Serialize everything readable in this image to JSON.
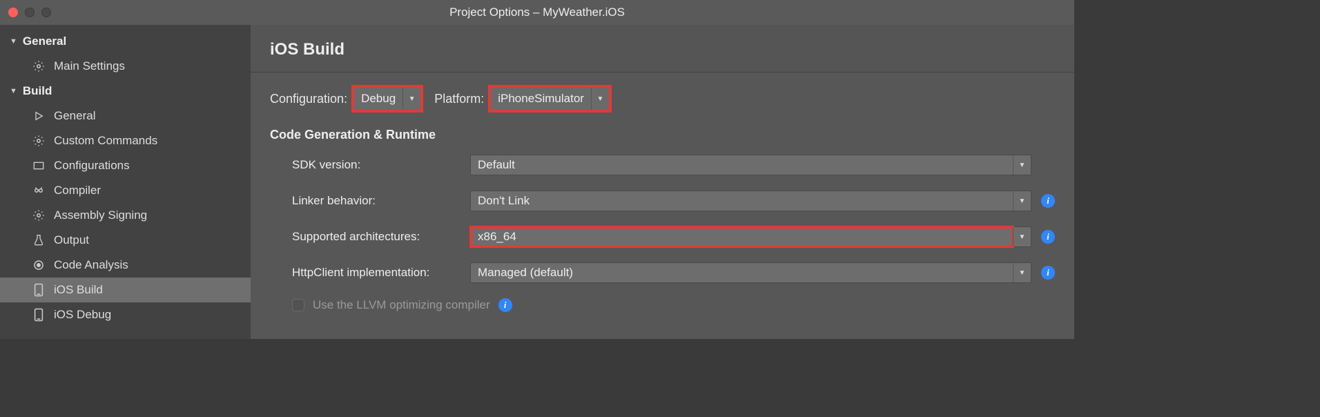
{
  "window": {
    "title": "Project Options – MyWeather.iOS"
  },
  "sidebar": {
    "general": {
      "label": "General",
      "items": [
        {
          "label": "Main Settings"
        }
      ]
    },
    "build": {
      "label": "Build",
      "items": [
        {
          "label": "General"
        },
        {
          "label": "Custom Commands"
        },
        {
          "label": "Configurations"
        },
        {
          "label": "Compiler"
        },
        {
          "label": "Assembly Signing"
        },
        {
          "label": "Output"
        },
        {
          "label": "Code Analysis"
        },
        {
          "label": "iOS Build"
        },
        {
          "label": "iOS Debug"
        }
      ]
    }
  },
  "main": {
    "heading": "iOS Build",
    "config": {
      "configuration_label": "Configuration:",
      "configuration_value": "Debug",
      "platform_label": "Platform:",
      "platform_value": "iPhoneSimulator"
    },
    "section_title": "Code Generation & Runtime",
    "rows": {
      "sdk_label": "SDK version:",
      "sdk_value": "Default",
      "linker_label": "Linker behavior:",
      "linker_value": "Don't Link",
      "arch_label": "Supported architectures:",
      "arch_value": "x86_64",
      "http_label": "HttpClient implementation:",
      "http_value": "Managed (default)",
      "llvm_label": "Use the LLVM optimizing compiler"
    }
  }
}
